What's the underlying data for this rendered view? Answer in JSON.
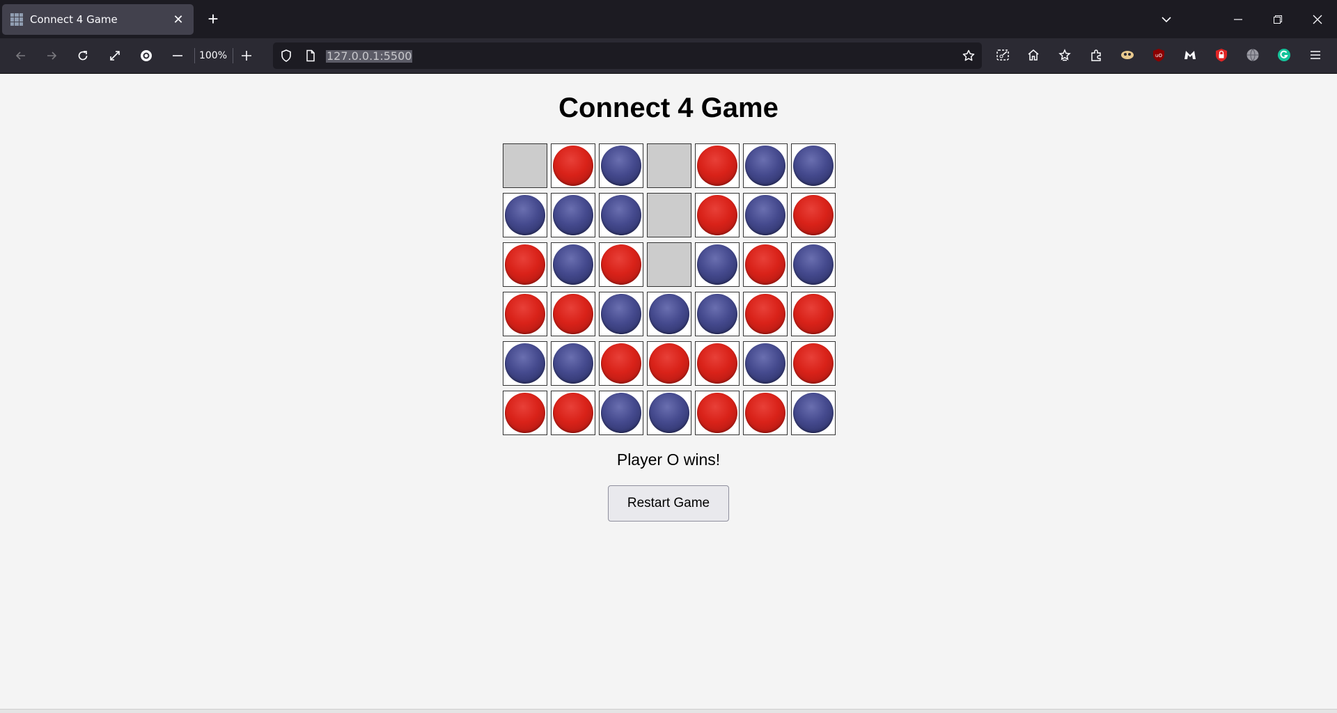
{
  "browser": {
    "tab_title": "Connect 4 Game",
    "tab_close": "✕",
    "new_tab": "+",
    "zoom_level": "100%",
    "url": "127.0.0.1:5500"
  },
  "game": {
    "title": "Connect 4 Game",
    "status": "Player O wins!",
    "restart_label": "Restart Game",
    "colors": {
      "R": "#d92219",
      "O": "#454a8e",
      "empty": "#cccccc"
    },
    "board": [
      [
        "",
        "R",
        "O",
        "",
        "R",
        "O",
        "O"
      ],
      [
        "O",
        "O",
        "O",
        "",
        "R",
        "O",
        "R"
      ],
      [
        "R",
        "O",
        "R",
        "",
        "O",
        "R",
        "O"
      ],
      [
        "R",
        "R",
        "O",
        "O",
        "O",
        "R",
        "R"
      ],
      [
        "O",
        "O",
        "R",
        "R",
        "R",
        "O",
        "R"
      ],
      [
        "R",
        "R",
        "O",
        "O",
        "R",
        "R",
        "O"
      ]
    ]
  }
}
